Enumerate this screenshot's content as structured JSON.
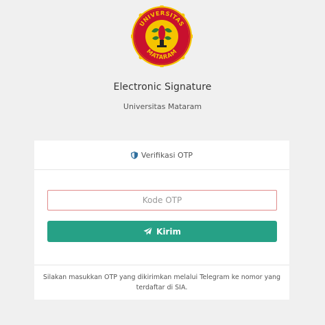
{
  "header": {
    "logo_ring_top_text": "UNIVERSITAS",
    "logo_ring_bottom_text": "MATARAM",
    "title": "Electronic Signature",
    "subtitle": "Universitas Mataram"
  },
  "card": {
    "header_label": "Verifikasi OTP",
    "otp_placeholder": "Kode OTP",
    "otp_value": "",
    "submit_label": "Kirim",
    "footer_text": "Silakan masukkan OTP yang dikirimkan melalui Telegram ke nomor yang terdaftar di SIA."
  },
  "icons": {
    "logo": "university-seal-icon",
    "header": "shield-icon",
    "submit": "paper-plane-icon"
  },
  "colors": {
    "background": "#f0f0f0",
    "primary": "#26a186",
    "input_border_error": "#e08a8a",
    "logo_yellow": "#f5c400",
    "logo_red": "#c8102e"
  }
}
